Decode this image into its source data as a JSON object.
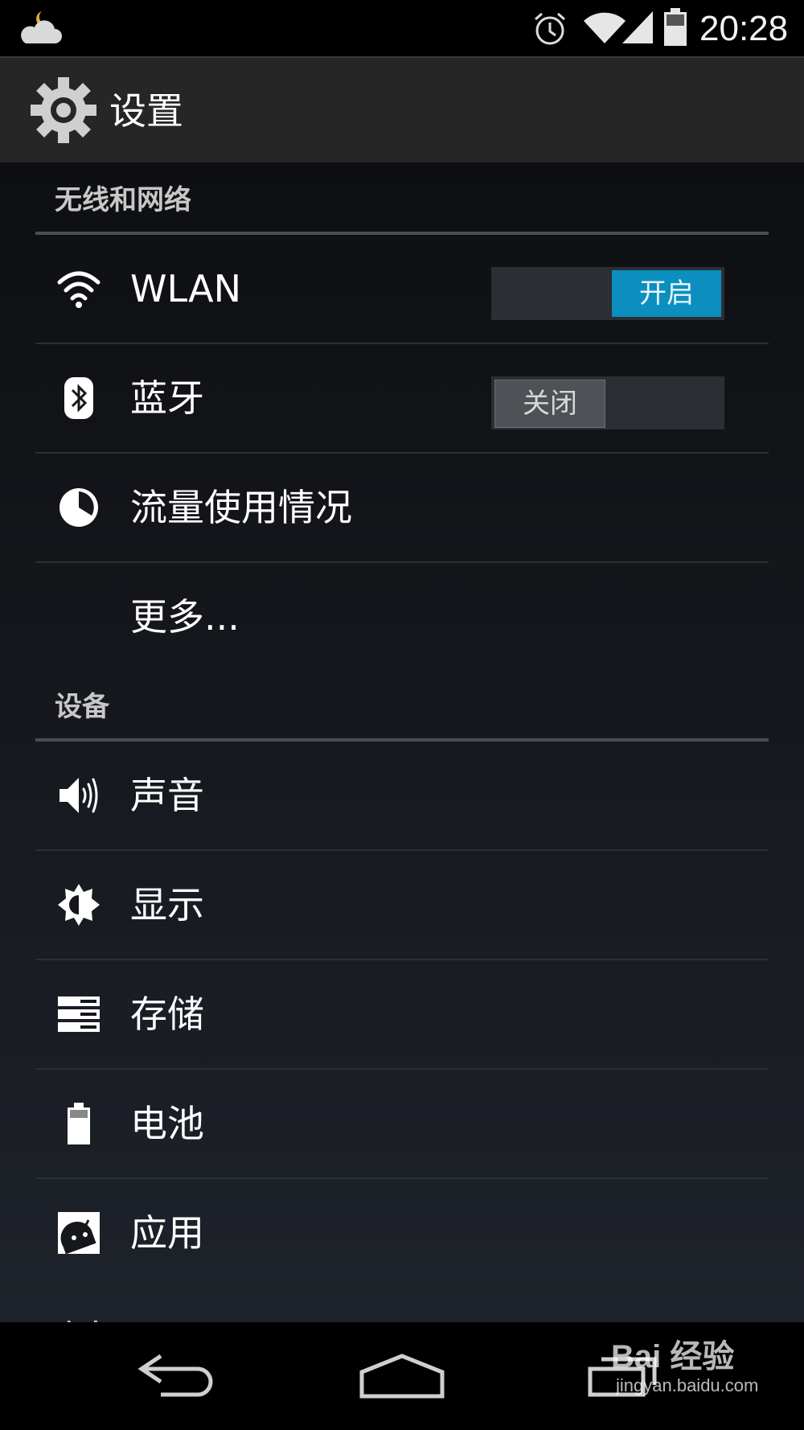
{
  "status_bar": {
    "time": "20:28",
    "icons": [
      "weather-cloud-moon-icon",
      "alarm-icon",
      "wifi-icon",
      "cell-signal-icon",
      "battery-icon"
    ]
  },
  "action_bar": {
    "title": "设置",
    "icon": "settings-gear-icon"
  },
  "sections": {
    "wireless": {
      "header": "无线和网络",
      "items": [
        {
          "label": "WLAN",
          "icon": "wifi-icon",
          "toggle": "开启",
          "toggle_state": "on"
        },
        {
          "label": "蓝牙",
          "icon": "bluetooth-icon",
          "toggle": "关闭",
          "toggle_state": "off"
        },
        {
          "label": "流量使用情况",
          "icon": "data-usage-icon"
        },
        {
          "label": "更多..."
        }
      ]
    },
    "device": {
      "header": "设备",
      "items": [
        {
          "label": "声音",
          "icon": "volume-icon"
        },
        {
          "label": "显示",
          "icon": "brightness-icon"
        },
        {
          "label": "存储",
          "icon": "storage-icon"
        },
        {
          "label": "电池",
          "icon": "battery-icon"
        },
        {
          "label": "应用",
          "icon": "apps-android-icon"
        }
      ]
    },
    "personal": {
      "header": "个人"
    }
  },
  "nav_bar": {
    "icons": [
      "back-icon",
      "home-icon",
      "recent-apps-icon"
    ]
  },
  "watermark": {
    "logo": "Bai 经验",
    "url": "jingyan.baidu.com"
  },
  "colors": {
    "accent": "#0c8fbf",
    "background": "#121418",
    "action_bar": "#262626",
    "divider": "#4a4d52"
  }
}
